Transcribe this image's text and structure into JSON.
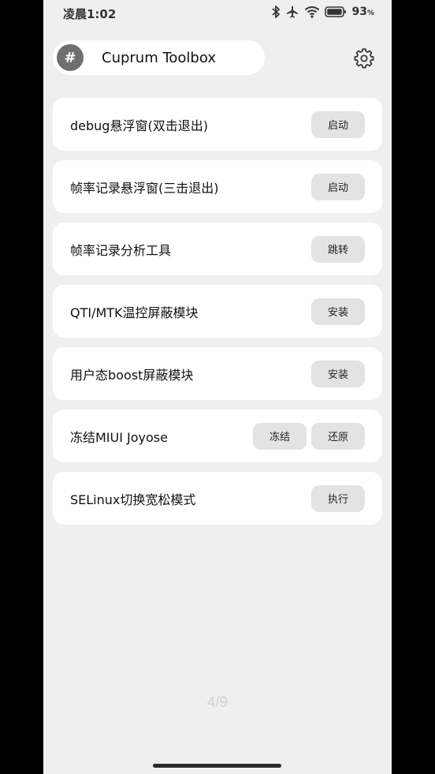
{
  "status_bar": {
    "time": "凌晨1:02",
    "battery": "93",
    "battery_unit": "%"
  },
  "header": {
    "badge": "#",
    "title": "Cuprum Toolbox",
    "settings_icon": "gear-icon"
  },
  "cards": [
    {
      "label": "debug悬浮窗(双击退出)",
      "buttons": [
        "启动"
      ]
    },
    {
      "label": "帧率记录悬浮窗(三击退出)",
      "buttons": [
        "启动"
      ]
    },
    {
      "label": "帧率记录分析工具",
      "buttons": [
        "跳转"
      ]
    },
    {
      "label": "QTI/MTK温控屏蔽模块",
      "buttons": [
        "安装"
      ]
    },
    {
      "label": "用户态boost屏蔽模块",
      "buttons": [
        "安装"
      ]
    },
    {
      "label": "冻结MIUI Joyose",
      "buttons": [
        "冻结",
        "还原"
      ]
    },
    {
      "label": "SELinux切换宽松模式",
      "buttons": [
        "执行"
      ]
    }
  ],
  "page_indicator": "4/9",
  "colors": {
    "background": "#efefef",
    "card": "#ffffff",
    "button": "#e3e3e3",
    "badge": "#6f6f6f"
  }
}
